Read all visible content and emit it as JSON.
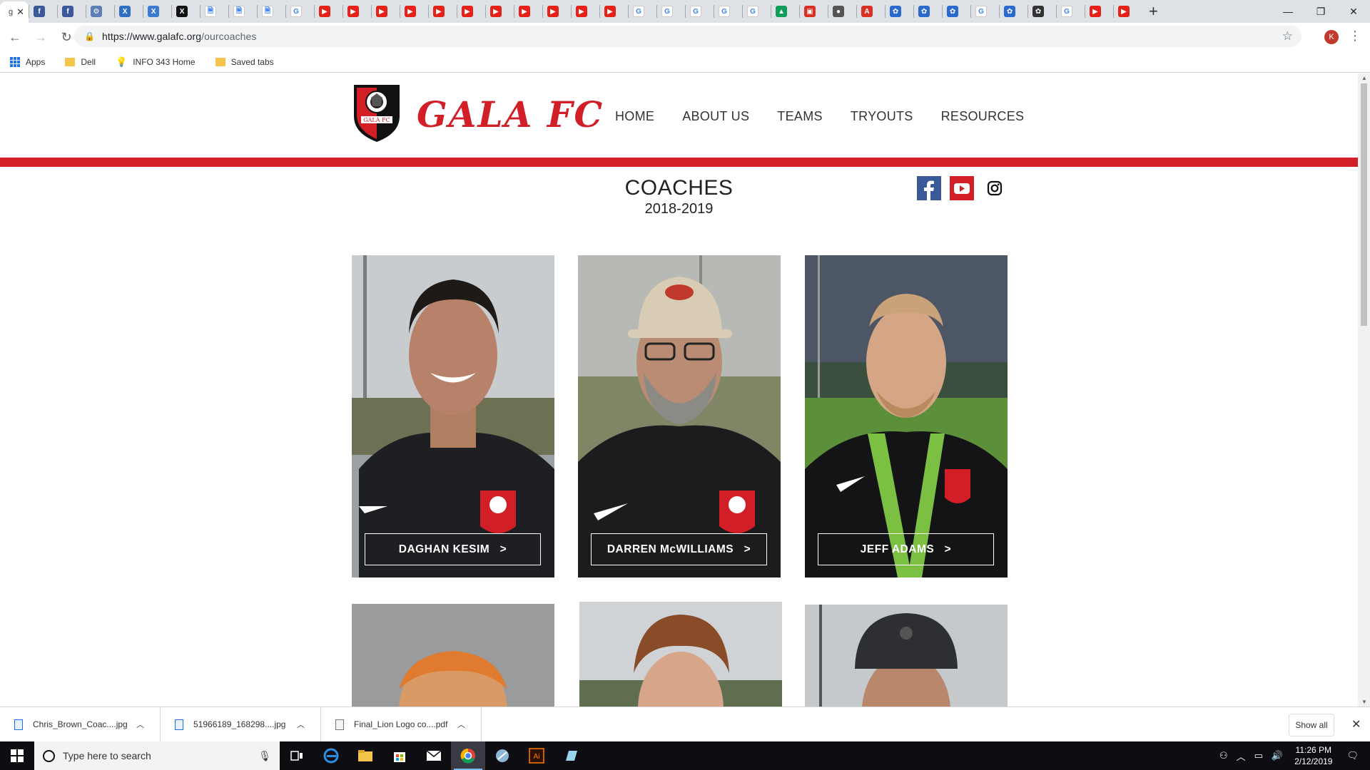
{
  "browser": {
    "active_tab_initial": "g",
    "url_host": "https://www.galafc.org",
    "url_path": "/ourcoaches",
    "tabs": [
      {
        "color": "#3b5998",
        "glyph": "f"
      },
      {
        "color": "#3b5998",
        "glyph": "f"
      },
      {
        "color": "#5b7fb5",
        "glyph": "⚙"
      },
      {
        "color": "#2f6fc4",
        "glyph": "X"
      },
      {
        "color": "#3b7bd1",
        "glyph": "X"
      },
      {
        "color": "#111111",
        "glyph": "X"
      },
      {
        "color": "#ffffff",
        "glyph": "🗎"
      },
      {
        "color": "#ffffff",
        "glyph": "🗎"
      },
      {
        "color": "#ffffff",
        "glyph": "🗎"
      },
      {
        "color": "#ffffff",
        "glyph": "G"
      },
      {
        "color": "#e62117",
        "glyph": "▶"
      },
      {
        "color": "#e62117",
        "glyph": "▶"
      },
      {
        "color": "#e62117",
        "glyph": "▶"
      },
      {
        "color": "#e62117",
        "glyph": "▶"
      },
      {
        "color": "#e62117",
        "glyph": "▶"
      },
      {
        "color": "#e62117",
        "glyph": "▶"
      },
      {
        "color": "#e62117",
        "glyph": "▶"
      },
      {
        "color": "#e62117",
        "glyph": "▶"
      },
      {
        "color": "#e62117",
        "glyph": "▶"
      },
      {
        "color": "#e62117",
        "glyph": "▶"
      },
      {
        "color": "#e62117",
        "glyph": "▶"
      },
      {
        "color": "#ffffff",
        "glyph": "G"
      },
      {
        "color": "#ffffff",
        "glyph": "G"
      },
      {
        "color": "#ffffff",
        "glyph": "G"
      },
      {
        "color": "#ffffff",
        "glyph": "G"
      },
      {
        "color": "#ffffff",
        "glyph": "G"
      },
      {
        "color": "#0f9d58",
        "glyph": "▲"
      },
      {
        "color": "#d93025",
        "glyph": "▣"
      },
      {
        "color": "#555555",
        "glyph": "●"
      },
      {
        "color": "#d93025",
        "glyph": "A"
      },
      {
        "color": "#2a6acf",
        "glyph": "✿"
      },
      {
        "color": "#2a6acf",
        "glyph": "✿"
      },
      {
        "color": "#2a6acf",
        "glyph": "✿"
      },
      {
        "color": "#ffffff",
        "glyph": "G"
      },
      {
        "color": "#2a6acf",
        "glyph": "✿"
      },
      {
        "color": "#333333",
        "glyph": "✿"
      },
      {
        "color": "#ffffff",
        "glyph": "G"
      },
      {
        "color": "#e62117",
        "glyph": "▶"
      },
      {
        "color": "#e62117",
        "glyph": "▶"
      }
    ],
    "bookmarks": [
      {
        "label": "Apps",
        "icon": "apps-grid-icon"
      },
      {
        "label": "Dell",
        "icon": "folder-icon"
      },
      {
        "label": "INFO 343 Home",
        "icon": "lightbulb-icon"
      },
      {
        "label": "Saved tabs",
        "icon": "folder-icon"
      }
    ],
    "profile_initial": "K"
  },
  "site": {
    "logo_text": "GALA FC",
    "crest_text": "GALA FC",
    "nav": [
      "HOME",
      "ABOUT US",
      "TEAMS",
      "TRYOUTS",
      "RESOURCES"
    ],
    "title": "COACHES",
    "subtitle": "2018-2019",
    "colors": {
      "brand_red": "#d21f27",
      "facebook": "#3b5998"
    },
    "coaches": [
      {
        "name": "DAGHAN KESIM",
        "arrow": ">"
      },
      {
        "name": "DARREN McWILLIAMS",
        "arrow": ">"
      },
      {
        "name": "JEFF ADAMS",
        "arrow": ">"
      }
    ]
  },
  "downloads": {
    "items": [
      {
        "name": "Chris_Brown_Coac....jpg"
      },
      {
        "name": "51966189_168298....jpg"
      },
      {
        "name": "Final_Lion Logo co....pdf"
      }
    ],
    "show_all": "Show all"
  },
  "taskbar": {
    "search_placeholder": "Type here to search",
    "time": "11:26 PM",
    "date": "2/12/2019"
  }
}
